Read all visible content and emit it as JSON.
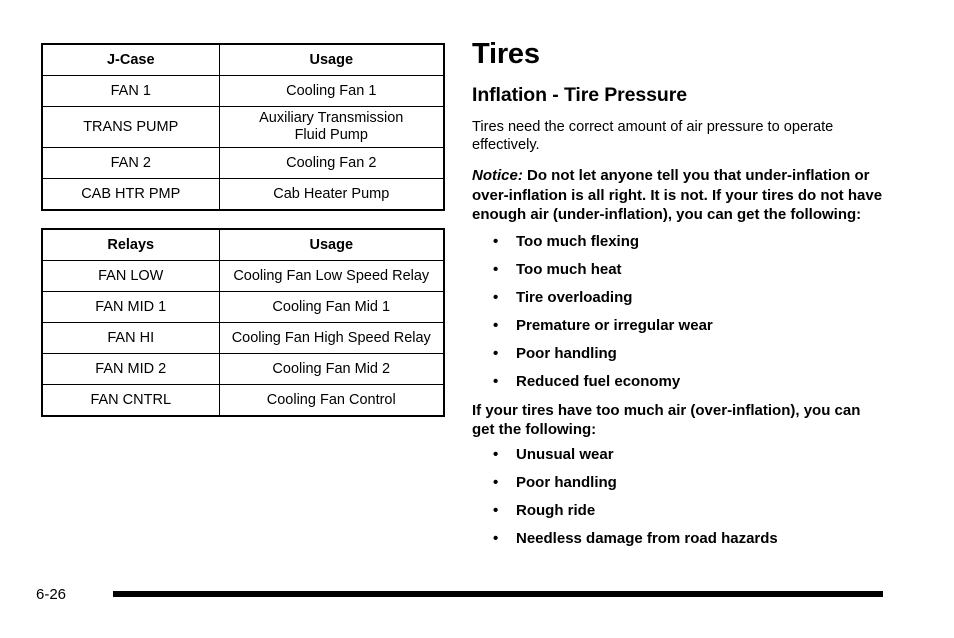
{
  "document": {
    "page_number": "6-26"
  },
  "tables": [
    {
      "name": "j-case-fuse-table",
      "headers": [
        "J-Case",
        "Usage"
      ],
      "rows": [
        [
          "FAN 1",
          "Cooling Fan 1"
        ],
        [
          "TRANS PUMP",
          "Auxiliary Transmission\nFluid Pump"
        ],
        [
          "FAN 2",
          "Cooling Fan 2"
        ],
        [
          "CAB HTR PMP",
          "Cab Heater Pump"
        ]
      ]
    },
    {
      "name": "relays-table",
      "headers": [
        "Relays",
        "Usage"
      ],
      "rows": [
        [
          "FAN LOW",
          "Cooling Fan Low Speed Relay"
        ],
        [
          "FAN MID 1",
          "Cooling Fan Mid 1"
        ],
        [
          "FAN HI",
          "Cooling Fan High Speed Relay"
        ],
        [
          "FAN MID 2",
          "Cooling Fan Mid 2"
        ],
        [
          "FAN CNTRL",
          "Cooling Fan Control"
        ]
      ]
    }
  ],
  "article": {
    "title": "Tires",
    "subtitle": "Inflation - Tire Pressure",
    "intro": "Tires need the correct amount of air pressure to operate effectively.",
    "notice_label": "Notice:",
    "notice_text": "Do not let anyone tell you that under-inflation or over-inflation is all right. It is not. If your tires do not have enough air (under-inflation), you can get the following:",
    "under_inflation_items": [
      "Too much flexing",
      "Too much heat",
      "Tire overloading",
      "Premature or irregular wear",
      "Poor handling",
      "Reduced fuel economy"
    ],
    "over_inflation_lead": "If your tires have too much air (over-inflation), you can get the following:",
    "over_inflation_items": [
      "Unusual wear",
      "Poor handling",
      "Rough ride",
      "Needless damage from road hazards"
    ],
    "bullet_glyph": "•"
  }
}
